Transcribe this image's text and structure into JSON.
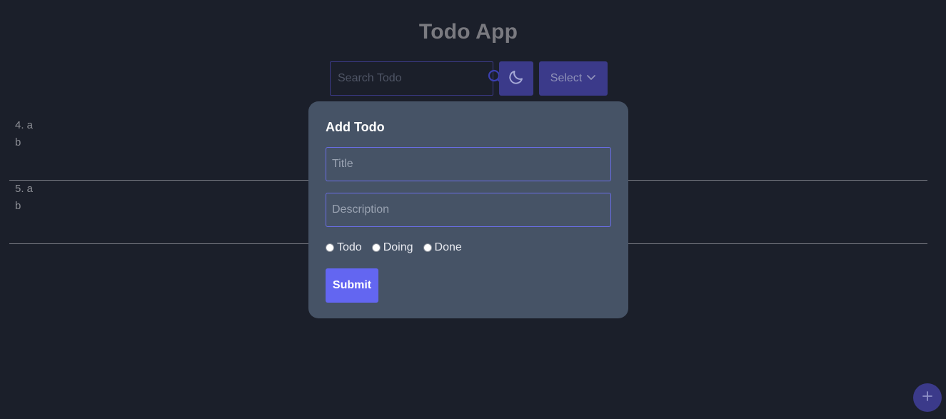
{
  "app": {
    "title": "Todo App"
  },
  "toolbar": {
    "search_placeholder": "Search Todo",
    "search_icon": "search-icon",
    "theme_icon": "moon-icon",
    "select_label": "Select",
    "select_icon": "chevron-down-icon",
    "accent_color": "#3b3a8a"
  },
  "todos": [
    {
      "title": "4. a",
      "description": "b"
    },
    {
      "title": "5. a",
      "description": "b"
    }
  ],
  "modal": {
    "heading": "Add Todo",
    "title_placeholder": "Title",
    "description_placeholder": "Description",
    "status_options": [
      {
        "label": "Todo",
        "checked": false
      },
      {
        "label": "Doing",
        "checked": false
      },
      {
        "label": "Done",
        "checked": false
      }
    ],
    "submit_label": "Submit",
    "submit_color": "#6366f1"
  },
  "fab": {
    "icon": "plus-icon"
  }
}
